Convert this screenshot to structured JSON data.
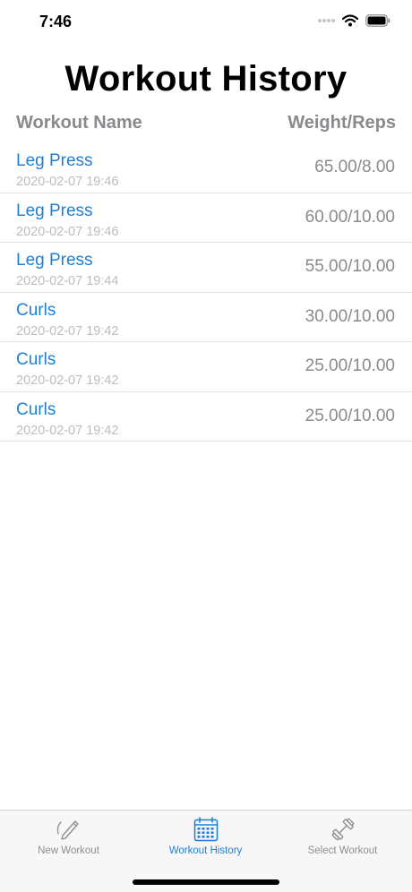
{
  "status_bar": {
    "time": "7:46",
    "icons": [
      "signal-dots-icon",
      "wifi-icon",
      "battery-icon"
    ]
  },
  "page": {
    "title": "Workout History"
  },
  "columns": {
    "left": "Workout Name",
    "right": "Weight/Reps"
  },
  "rows": [
    {
      "name": "Leg Press",
      "date": "2020-02-07 19:46",
      "value": "65.00/8.00"
    },
    {
      "name": "Leg Press",
      "date": "2020-02-07 19:46",
      "value": "60.00/10.00"
    },
    {
      "name": "Leg Press",
      "date": "2020-02-07 19:44",
      "value": "55.00/10.00"
    },
    {
      "name": "Curls",
      "date": "2020-02-07 19:42",
      "value": "30.00/10.00"
    },
    {
      "name": "Curls",
      "date": "2020-02-07 19:42",
      "value": "25.00/10.00"
    },
    {
      "name": "Curls",
      "date": "2020-02-07 19:42",
      "value": "25.00/10.00"
    }
  ],
  "tab_bar": {
    "tabs": [
      {
        "label": "New Workout",
        "icon": "pencil-icon",
        "active": false
      },
      {
        "label": "Workout History",
        "icon": "calendar-icon",
        "active": true
      },
      {
        "label": "Select Workout",
        "icon": "dumbbell-icon",
        "active": false
      }
    ]
  },
  "colors": {
    "accent": "#1e7fd6",
    "secondary_text": "#8a8a8e",
    "date_text": "#bdbdc1",
    "separator": "#e3e3e6",
    "tab_bar_background": "#f7f7f7"
  }
}
